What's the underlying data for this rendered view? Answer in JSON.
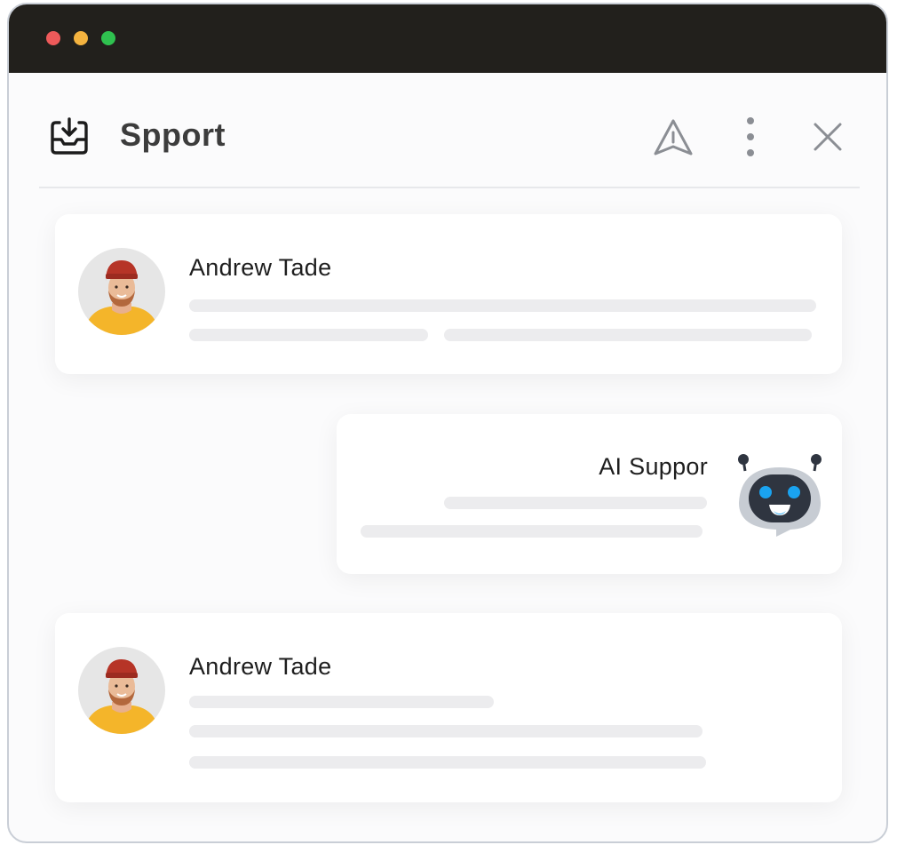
{
  "window": {
    "title": "Spport",
    "controls": [
      "close-dot",
      "minimize-dot",
      "maximize-dot"
    ]
  },
  "header": {
    "icons": [
      "inbox-download-icon",
      "warning-icon",
      "more-vertical-icon",
      "close-icon"
    ]
  },
  "messages": [
    {
      "author": "Andrew Tade",
      "kind": "user"
    },
    {
      "author": "AI Suppor",
      "kind": "bot"
    },
    {
      "author": "Andrew Tade",
      "kind": "user"
    }
  ],
  "colors": {
    "titlebar": "#22201c",
    "dot_red": "#ee5a5a",
    "dot_yellow": "#f4b33f",
    "dot_green": "#2fc14f",
    "bot_eyes": "#1aa3f0"
  }
}
